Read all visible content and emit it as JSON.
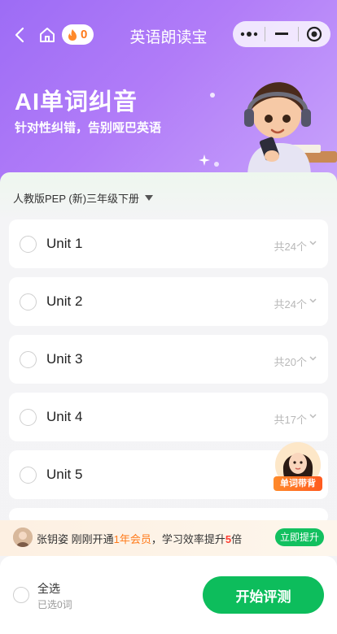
{
  "nav": {
    "title": "英语朗读宝",
    "fire_count": "0"
  },
  "hero": {
    "title": "AI单词纠音",
    "subtitle": "针对性纠错，告别哑巴英语"
  },
  "edition": {
    "label": "人教版PEP (新)三年级下册"
  },
  "units": [
    {
      "name": "Unit 1",
      "count": "共24个"
    },
    {
      "name": "Unit 2",
      "count": "共24个"
    },
    {
      "name": "Unit 3",
      "count": "共20个"
    },
    {
      "name": "Unit 4",
      "count": "共17个"
    },
    {
      "name": "Unit 5",
      "count": "共"
    }
  ],
  "promo": {
    "teacher_badge": "单词带背"
  },
  "notice": {
    "user": "张钥姿",
    "text_1": " 刚刚开通",
    "highlight": "1年会员",
    "text_2": "，学习效率提升",
    "multiplier": "5",
    "text_3": "倍",
    "button": "立即提升"
  },
  "footer": {
    "select_all": "全选",
    "selected_count": "已选0词",
    "start_button": "开始评测"
  },
  "colors": {
    "hero_purple": "#9d6cf5",
    "accent_green": "#0dbd5c",
    "accent_orange": "#ff7a1a"
  }
}
